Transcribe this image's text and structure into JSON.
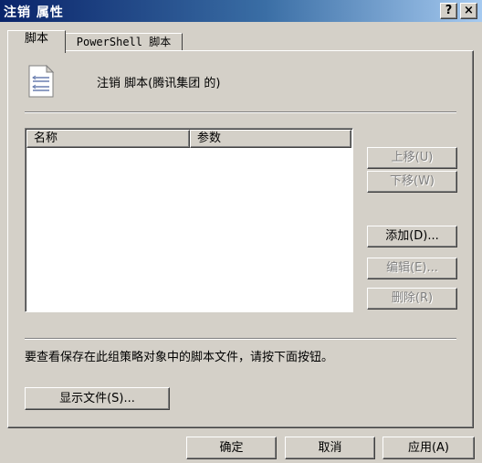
{
  "window": {
    "title": "注销 属性",
    "help_button": "?",
    "close_button": "×"
  },
  "tabs": [
    {
      "label": "脚本"
    },
    {
      "label": "PowerShell 脚本"
    }
  ],
  "header": {
    "icon": "script-document-icon",
    "description": "注销 脚本(腾讯集团 的)"
  },
  "list": {
    "columns": [
      "名称",
      "参数"
    ],
    "rows": []
  },
  "side_buttons": {
    "move_up": "上移(U)",
    "move_down": "下移(W)",
    "add": "添加(D)...",
    "edit": "编辑(E)...",
    "remove": "删除(R)"
  },
  "info_text": "要查看保存在此组策略对象中的脚本文件，请按下面按钮。",
  "show_files_button": "显示文件(S)...",
  "footer": {
    "ok": "确定",
    "cancel": "取消",
    "apply": "应用(A)"
  }
}
